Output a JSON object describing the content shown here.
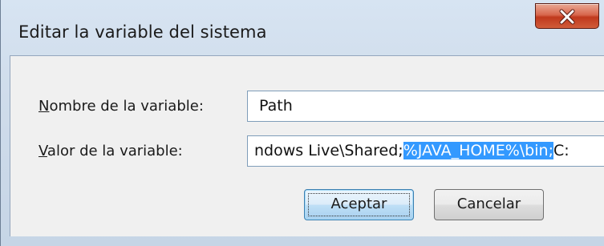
{
  "window": {
    "title": "Editar la variable del sistema"
  },
  "icons": {
    "close": "close-x-icon"
  },
  "form": {
    "name_label_accel": "N",
    "name_label_rest": "ombre de la variable:",
    "name_value": "Path",
    "value_label_accel": "V",
    "value_label_rest": "alor de la variable:",
    "value_text_before": "ndows Live\\Shared;",
    "value_text_selected": "%JAVA_HOME%\\bin;",
    "value_text_after": "C:"
  },
  "buttons": {
    "ok_label": "Aceptar",
    "cancel_label": "Cancelar"
  },
  "colors": {
    "selection": "#3399ff",
    "close_button": "#c7432a"
  }
}
